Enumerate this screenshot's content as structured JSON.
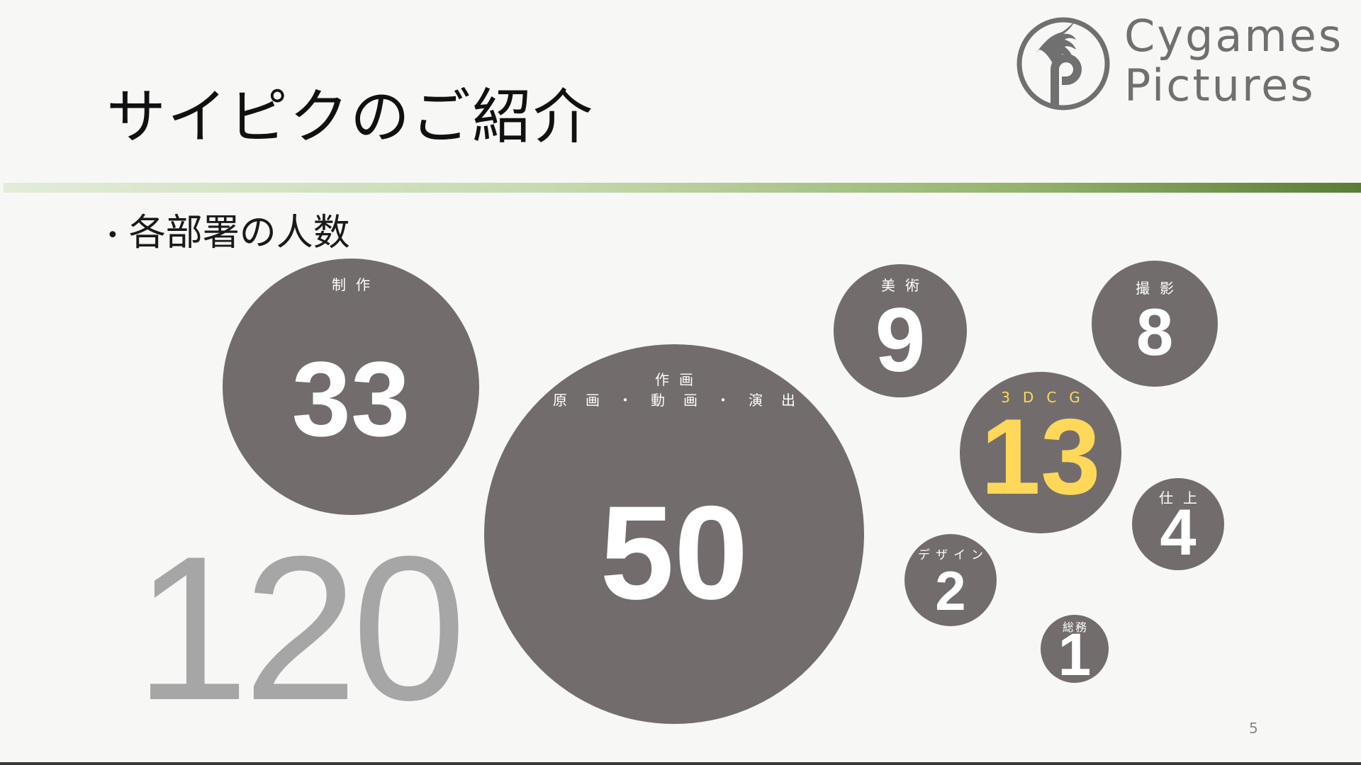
{
  "title": "サイピクのご紹介",
  "bullet": "各部署の人数",
  "logo": {
    "line1": "Cygames",
    "line2": "Pictures",
    "icon": "dragon-p-emblem"
  },
  "total": "120",
  "departments": [
    {
      "label": "制作",
      "count": "33"
    },
    {
      "label": "作画",
      "sublabel": "原画・動画・演出",
      "count": "50"
    },
    {
      "label": "美術",
      "count": "9"
    },
    {
      "label": "撮影",
      "count": "8"
    },
    {
      "label": "3DCG",
      "count": "13",
      "highlight": true
    },
    {
      "label": "仕上",
      "count": "4"
    },
    {
      "label": "デザイン",
      "count": "2"
    },
    {
      "label": "総務",
      "count": "1"
    }
  ],
  "page_number": "5",
  "colors": {
    "circle": "#726d6c",
    "highlight": "#ffd85a",
    "total": "#a6a6a6",
    "bar_end": "#5a7d34"
  }
}
